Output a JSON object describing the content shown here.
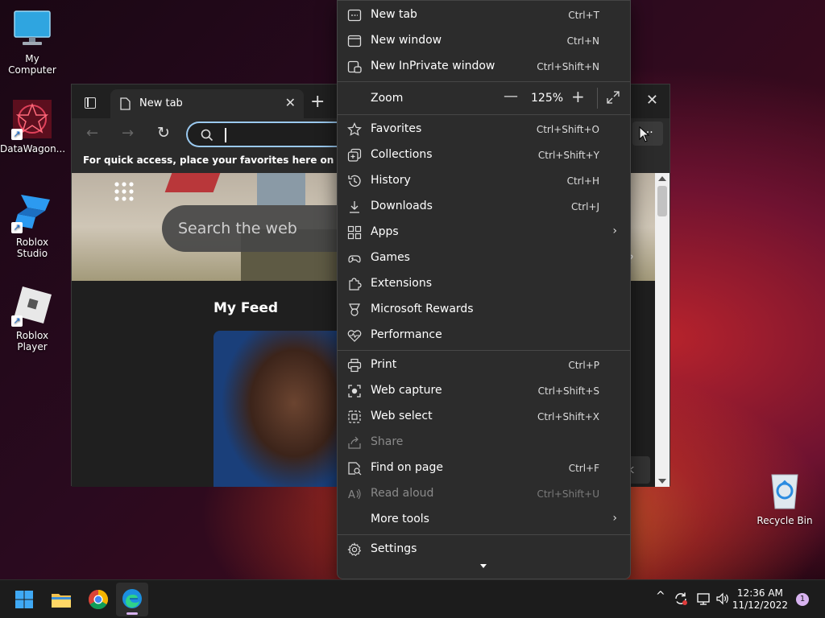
{
  "desktop": {
    "icons": [
      {
        "label": "My Computer"
      },
      {
        "label": "DataWagon..."
      },
      {
        "label": "Roblox Studio"
      },
      {
        "label": "Roblox Player"
      },
      {
        "label": "Recycle Bin"
      }
    ]
  },
  "browser": {
    "tab_title": "New tab",
    "favorites_hint": "For quick access, place your favorites here on the favorites",
    "search_placeholder": "Search the web",
    "feed_title": "My Feed",
    "peek_text_1": "?",
    "peek_text_2": "k"
  },
  "menu": {
    "zoom_label": "Zoom",
    "zoom_value": "125%",
    "items": [
      {
        "label": "New tab",
        "shortcut": "Ctrl+T"
      },
      {
        "label": "New window",
        "shortcut": "Ctrl+N"
      },
      {
        "label": "New InPrivate window",
        "shortcut": "Ctrl+Shift+N"
      },
      {
        "label": "Favorites",
        "shortcut": "Ctrl+Shift+O"
      },
      {
        "label": "Collections",
        "shortcut": "Ctrl+Shift+Y"
      },
      {
        "label": "History",
        "shortcut": "Ctrl+H"
      },
      {
        "label": "Downloads",
        "shortcut": "Ctrl+J"
      },
      {
        "label": "Apps",
        "shortcut": ""
      },
      {
        "label": "Games",
        "shortcut": ""
      },
      {
        "label": "Extensions",
        "shortcut": ""
      },
      {
        "label": "Microsoft Rewards",
        "shortcut": ""
      },
      {
        "label": "Performance",
        "shortcut": ""
      },
      {
        "label": "Print",
        "shortcut": "Ctrl+P"
      },
      {
        "label": "Web capture",
        "shortcut": "Ctrl+Shift+S"
      },
      {
        "label": "Web select",
        "shortcut": "Ctrl+Shift+X"
      },
      {
        "label": "Share",
        "shortcut": ""
      },
      {
        "label": "Find on page",
        "shortcut": "Ctrl+F"
      },
      {
        "label": "Read aloud",
        "shortcut": "Ctrl+Shift+U"
      },
      {
        "label": "More tools",
        "shortcut": ""
      },
      {
        "label": "Settings",
        "shortcut": ""
      }
    ]
  },
  "taskbar": {
    "time": "12:36 AM",
    "date": "11/12/2022",
    "notification_count": "1"
  },
  "colors": {
    "menu_bg": "#2c2c2c",
    "edge_blue": "#1b8fe0"
  }
}
